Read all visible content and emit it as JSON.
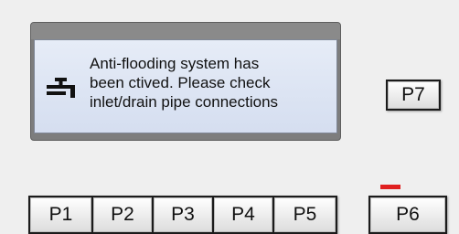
{
  "display": {
    "message": "Anti-flooding system has\nbeen   ctived. Please check\ninlet/drain pipe connections",
    "icon": "tap-icon"
  },
  "keys": {
    "p1": "P1",
    "p2": "P2",
    "p3": "P3",
    "p4": "P4",
    "p5": "P5",
    "p6": "P6",
    "p7": "P7"
  },
  "colors": {
    "indicator": "#e02020",
    "panel": "#dbe3f3",
    "background": "#efefef"
  }
}
